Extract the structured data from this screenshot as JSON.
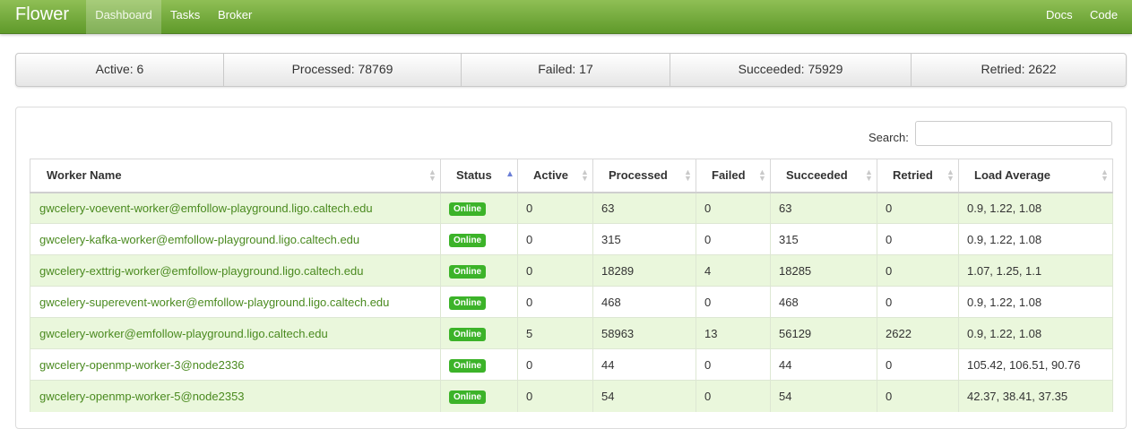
{
  "navbar": {
    "brand": "Flower",
    "links": [
      "Dashboard",
      "Tasks",
      "Broker"
    ],
    "right_links": [
      "Docs",
      "Code"
    ],
    "active": "Dashboard"
  },
  "stats": [
    {
      "label": "Active: 6"
    },
    {
      "label": "Processed: 78769"
    },
    {
      "label": "Failed: 17"
    },
    {
      "label": "Succeeded: 75929"
    },
    {
      "label": "Retried: 2622"
    }
  ],
  "search": {
    "label": "Search:",
    "value": ""
  },
  "table": {
    "columns": [
      "Worker Name",
      "Status",
      "Active",
      "Processed",
      "Failed",
      "Succeeded",
      "Retried",
      "Load Average"
    ],
    "sorted_column": "Status",
    "rows": [
      {
        "name": "gwcelery-voevent-worker@emfollow-playground.ligo.caltech.edu",
        "status": "Online",
        "active": "0",
        "processed": "63",
        "failed": "0",
        "succeeded": "63",
        "retried": "0",
        "load": "0.9, 1.22, 1.08"
      },
      {
        "name": "gwcelery-kafka-worker@emfollow-playground.ligo.caltech.edu",
        "status": "Online",
        "active": "0",
        "processed": "315",
        "failed": "0",
        "succeeded": "315",
        "retried": "0",
        "load": "0.9, 1.22, 1.08"
      },
      {
        "name": "gwcelery-exttrig-worker@emfollow-playground.ligo.caltech.edu",
        "status": "Online",
        "active": "0",
        "processed": "18289",
        "failed": "4",
        "succeeded": "18285",
        "retried": "0",
        "load": "1.07, 1.25, 1.1"
      },
      {
        "name": "gwcelery-superevent-worker@emfollow-playground.ligo.caltech.edu",
        "status": "Online",
        "active": "0",
        "processed": "468",
        "failed": "0",
        "succeeded": "468",
        "retried": "0",
        "load": "0.9, 1.22, 1.08"
      },
      {
        "name": "gwcelery-worker@emfollow-playground.ligo.caltech.edu",
        "status": "Online",
        "active": "5",
        "processed": "58963",
        "failed": "13",
        "succeeded": "56129",
        "retried": "2622",
        "load": "0.9, 1.22, 1.08"
      },
      {
        "name": "gwcelery-openmp-worker-3@node2336",
        "status": "Online",
        "active": "0",
        "processed": "44",
        "failed": "0",
        "succeeded": "44",
        "retried": "0",
        "load": "105.42, 106.51, 90.76"
      },
      {
        "name": "gwcelery-openmp-worker-5@node2353",
        "status": "Online",
        "active": "0",
        "processed": "54",
        "failed": "0",
        "succeeded": "54",
        "retried": "0",
        "load": "42.37, 38.41, 37.35"
      }
    ]
  },
  "colors": {
    "navbar": "#6fa83a",
    "link": "#4a8a1f",
    "badge": "#3cb329",
    "row_stripe": "#eaf7dc"
  }
}
